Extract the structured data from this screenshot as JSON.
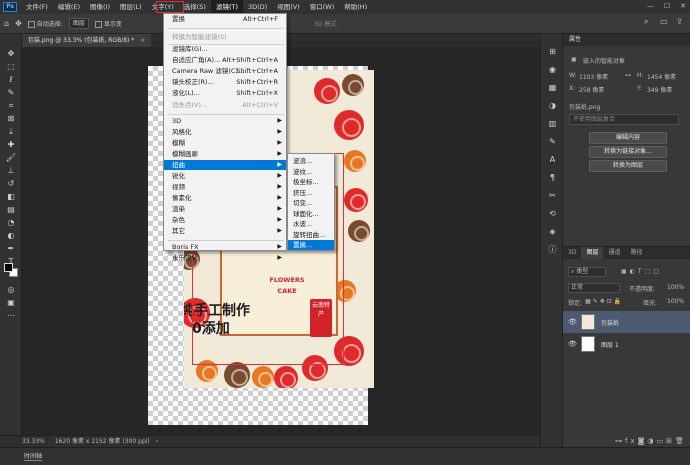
{
  "app": {
    "logo": "Ps",
    "menus": [
      "文件(F)",
      "编辑(E)",
      "图像(I)",
      "图层(L)",
      "文字(Y)",
      "选择(S)",
      "滤镜(T)",
      "3D(D)",
      "视图(V)",
      "窗口(W)",
      "帮助(H)"
    ],
    "active_menu_index": 6,
    "window_controls": [
      "—",
      "☐",
      "✕"
    ]
  },
  "options_bar": {
    "auto_select_label": "自动选择:",
    "layer_select_value": "图层",
    "show_transform_label": "显示变",
    "mode_3d_label": "3D 模式:"
  },
  "document": {
    "tab_title": "包装.png @ 33.3% (包装纸, RGB/8) *",
    "close_glyph": "×"
  },
  "artwork": {
    "text_line1": "纯手工制作",
    "text_line2": "0添加",
    "badge_line1": "FLOWERS",
    "badge_line2": "CAKE",
    "seal_text": "云南特产"
  },
  "status_bar": {
    "zoom": "33.33%",
    "doc_info": "1620 像素 x 2152 像素 (300 ppi)",
    "arrow": "›"
  },
  "timeline": {
    "tab_label": "时间轴"
  },
  "properties": {
    "tab_label": "属性",
    "type_label": "嵌入的智能对象",
    "w_label": "W:",
    "w_value": "1103 像素",
    "h_label": "H:",
    "h_value": "1454 像素",
    "x_label": "X:",
    "x_value": "258 像素",
    "y_label": "Y:",
    "y_value": "349 像素",
    "file_name": "包装纸.png",
    "comp_placeholder": "不使用图层复合",
    "btn_edit": "编辑内容",
    "btn_convert_linked": "转换为链接对象...",
    "btn_convert_layer": "转换为图层"
  },
  "layers": {
    "tabs": [
      "3D",
      "图层",
      "通道",
      "路径"
    ],
    "active_tab": 1,
    "filter_kind": "类型",
    "blend_mode": "正常",
    "opacity_label": "不透明度:",
    "opacity_value": "100%",
    "lock_label": "锁定:",
    "fill_label": "填充:",
    "fill_value": "100%",
    "items": [
      {
        "name": "包装纸",
        "selected": true
      },
      {
        "name": "图层 1",
        "selected": false
      }
    ],
    "bottom_icons": [
      "link-icon",
      "fx-icon",
      "mask-icon",
      "adjust-icon",
      "folder-icon",
      "new-layer-icon",
      "trash-icon"
    ]
  },
  "filter_menu": {
    "items": [
      {
        "label": "置换",
        "shortcut": "Alt+Ctrl+F",
        "disabled": false
      },
      {
        "label": "转换为智能滤镜(S)",
        "shortcut": "",
        "disabled": true
      },
      {
        "label": "滤镜库(G)...",
        "shortcut": "",
        "disabled": false
      },
      {
        "label": "自适应广角(A)...",
        "shortcut": "Alt+Shift+Ctrl+A",
        "disabled": false
      },
      {
        "label": "Camera Raw 滤镜(C)...",
        "shortcut": "Shift+Ctrl+A",
        "disabled": false
      },
      {
        "label": "镜头校正(R)...",
        "shortcut": "Shift+Ctrl+R",
        "disabled": false
      },
      {
        "label": "液化(L)...",
        "shortcut": "Shift+Ctrl+X",
        "disabled": false
      },
      {
        "label": "消失点(V)...",
        "shortcut": "Alt+Ctrl+V",
        "disabled": true
      },
      {
        "label": "3D",
        "shortcut": "",
        "submenu": true
      },
      {
        "label": "风格化",
        "shortcut": "",
        "submenu": true
      },
      {
        "label": "模糊",
        "shortcut": "",
        "submenu": true
      },
      {
        "label": "模糊画廊",
        "shortcut": "",
        "submenu": true
      },
      {
        "label": "扭曲",
        "shortcut": "",
        "submenu": true,
        "highlight": true
      },
      {
        "label": "锐化",
        "shortcut": "",
        "submenu": true
      },
      {
        "label": "视频",
        "shortcut": "",
        "submenu": true
      },
      {
        "label": "像素化",
        "shortcut": "",
        "submenu": true
      },
      {
        "label": "渲染",
        "shortcut": "",
        "submenu": true
      },
      {
        "label": "杂色",
        "shortcut": "",
        "submenu": true
      },
      {
        "label": "其它",
        "shortcut": "",
        "submenu": true
      },
      {
        "label": "Boris FX",
        "shortcut": "",
        "submenu": true
      },
      {
        "label": "永乐汉化",
        "shortcut": "",
        "submenu": true
      }
    ],
    "submenu_arrow": "▶"
  },
  "distort_submenu": {
    "items": [
      "波浪...",
      "波纹...",
      "极坐标...",
      "挤压...",
      "切变...",
      "球面化...",
      "水波...",
      "旋转扭曲...",
      "置换..."
    ],
    "highlight_index": 8
  },
  "colors": {
    "accent": "#0078d7",
    "highlight_box": "#e0303a",
    "layer_selected": "#4c5a70"
  }
}
